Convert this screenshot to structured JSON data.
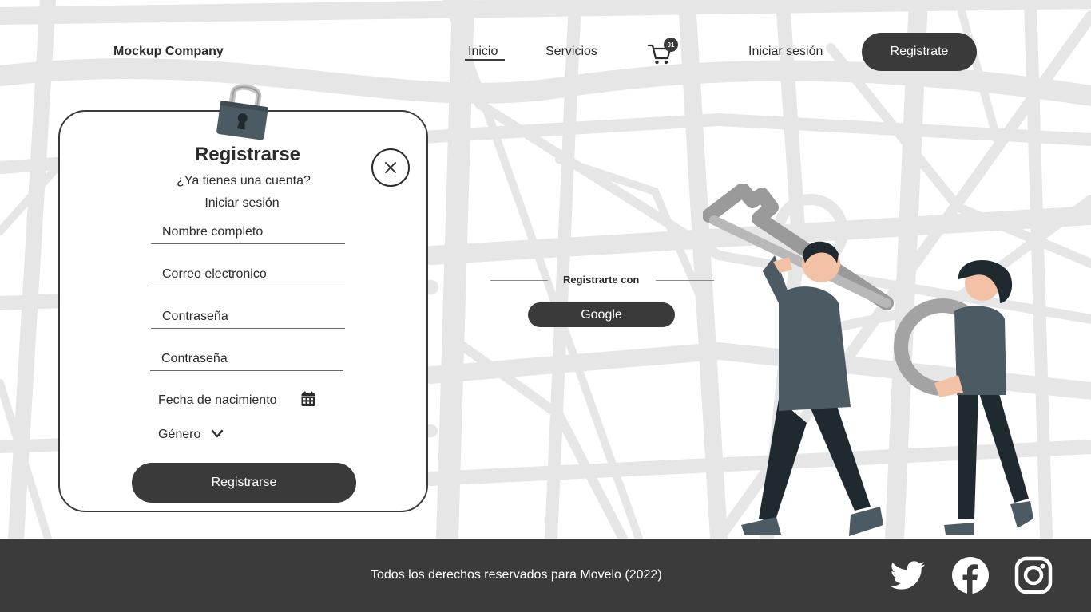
{
  "header": {
    "brand": "Mockup Company",
    "nav": {
      "home": "Inicio",
      "services": "Servicios",
      "login": "Iniciar sesión"
    },
    "cart_count": "01",
    "register": "Registrate"
  },
  "modal": {
    "title": "Registrarse",
    "subtitle": "¿Ya tienes una cuenta?",
    "login_link": "Iniciar sesión",
    "fields": {
      "fullname": "Nombre completo",
      "email": "Correo electronico",
      "password": "Contraseña",
      "password_confirm": "Contraseña"
    },
    "birthdate": "Fecha de nacimiento",
    "gender": "Género",
    "submit": "Registrarse"
  },
  "social": {
    "label": "Registrarte con",
    "google": "Google"
  },
  "footer": {
    "copyright": "Todos los derechos reservados para Movelo (2022)"
  },
  "colors": {
    "dark": "#3a3a3a",
    "map_streets": "#e6e6e6",
    "footer_bg": "#3b3b3b"
  },
  "icons": [
    "cart-icon",
    "lock-icon",
    "close-icon",
    "calendar-icon",
    "chevron-down-icon",
    "twitter-icon",
    "facebook-icon",
    "instagram-icon"
  ]
}
